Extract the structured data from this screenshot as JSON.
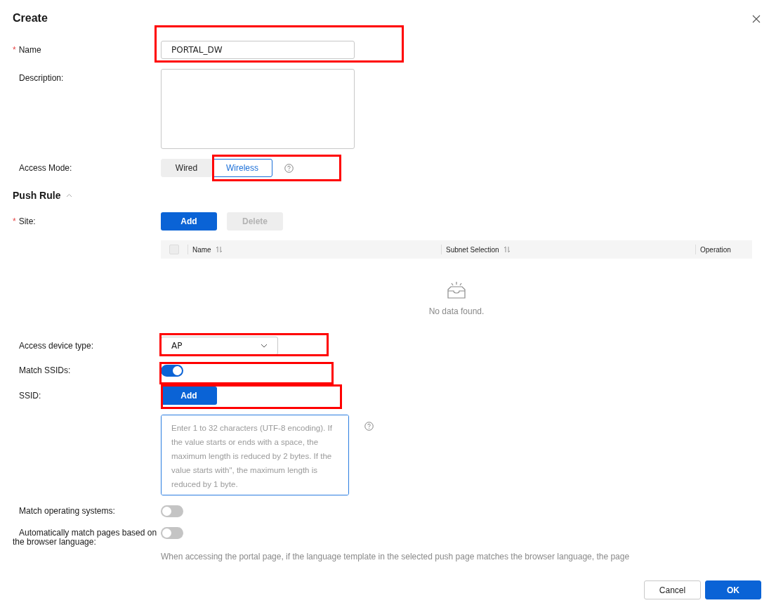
{
  "dialog": {
    "title": "Create"
  },
  "basic_rows": [
    {
      "kind": "text",
      "label": "Name",
      "required_mark": "*",
      "value": "PORTAL_DW",
      "highlighted": true
    },
    {
      "kind": "textarea",
      "label": "Description:"
    },
    {
      "kind": "segmented",
      "label": "Access Mode:",
      "highlighted": true,
      "options": [
        {
          "label": "Wired",
          "selected": false
        },
        {
          "label": "Wireless",
          "selected": true
        }
      ]
    }
  ],
  "push_rule": {
    "title": "Push Rule",
    "expanded": true,
    "rows": [
      {
        "kind": "table",
        "label": "Site:",
        "required_mark": "*",
        "buttons": [
          {
            "label": "Add",
            "disabled": false
          },
          {
            "label": "Delete",
            "disabled": true
          }
        ],
        "select_all_checked": false,
        "columns": [
          {
            "label": "Name",
            "sortable": true
          },
          {
            "label": "Subnet Selection",
            "sortable": true
          },
          {
            "label": "Operation"
          }
        ],
        "empty_text": "No data found."
      },
      {
        "kind": "select",
        "label": "Access device type:",
        "highlighted": true,
        "value": "AP"
      },
      {
        "kind": "toggle",
        "label": "Match SSIDs:",
        "highlighted": true,
        "on": true
      },
      {
        "kind": "list",
        "label": "SSID:",
        "highlighted": true,
        "button": "Add",
        "placeholder": "Enter 1 to 32 characters (UTF-8 encoding). If the value starts or ends with a space, the maximum length is reduced by 2 bytes. If the value starts with\", the maximum length is reduced by 1 byte."
      },
      {
        "kind": "toggle",
        "label": "Match operating systems:",
        "on": false
      },
      {
        "kind": "toggle",
        "label": "Automatically match pages based on the browser language:",
        "on": false,
        "note": "When accessing the portal page, if the language template in the selected push page matches the browser language, the page"
      }
    ]
  },
  "footer_buttons": [
    {
      "label": "Cancel",
      "kind": "default"
    },
    {
      "label": "OK",
      "kind": "primary"
    }
  ]
}
